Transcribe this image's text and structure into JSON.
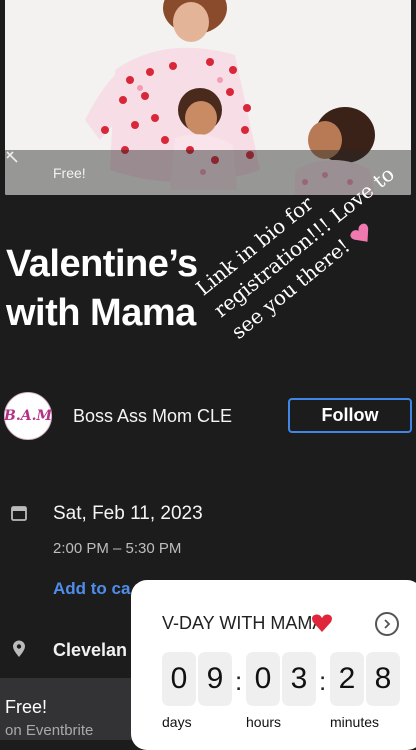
{
  "hero": {
    "badge_label": "Free!"
  },
  "event": {
    "title": "Valentine’s with Mama"
  },
  "overlay": {
    "line1": "Link in bio for",
    "line2": "registration!!! Love to",
    "line3": "see you there!"
  },
  "organizer": {
    "logo_text": "B.A.M",
    "name": "Boss Ass Mom CLE",
    "follow_label": "Follow"
  },
  "date": {
    "main": "Sat, Feb 11, 2023",
    "time": "2:00 PM – 5:30 PM",
    "add_calendar": "Add to ca"
  },
  "location": {
    "name": "Clevelan"
  },
  "footer": {
    "price": "Free!",
    "platform": "on Eventbrite"
  },
  "countdown": {
    "title": "V-DAY WITH MAMA",
    "digits": [
      "0",
      "9",
      "0",
      "3",
      "2",
      "8"
    ],
    "units": {
      "days": "days",
      "hours": "hours",
      "minutes": "minutes"
    }
  },
  "colors": {
    "accent": "#3f86e8",
    "link": "#4f8dea",
    "background": "#1c1c1d",
    "heart": "#e0263a"
  },
  "icons": {
    "tag": "tag-icon",
    "calendar": "calendar-icon",
    "pin": "pin-icon",
    "chevron": "chevron-right-icon",
    "heart": "heart-icon"
  }
}
